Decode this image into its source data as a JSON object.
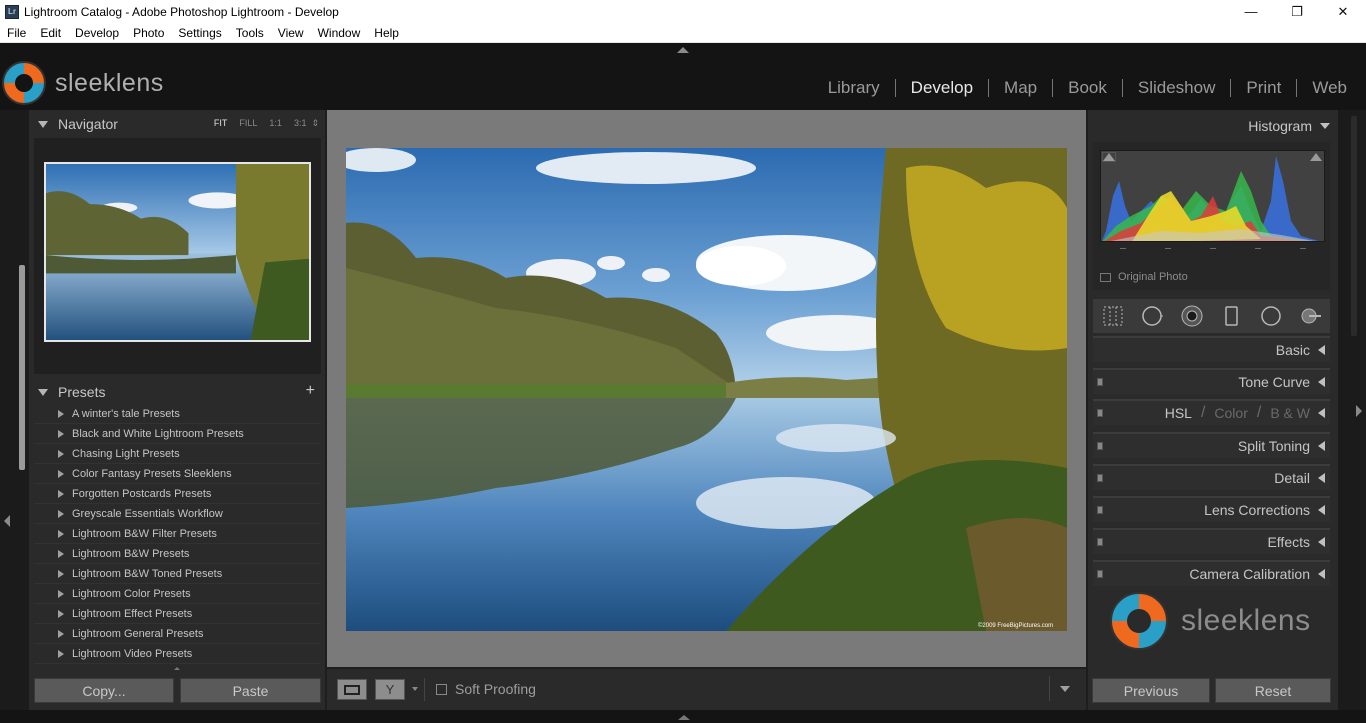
{
  "window": {
    "app_icon": "Lr",
    "title": "Lightroom Catalog - Adobe Photoshop Lightroom - Develop",
    "minimize": "—",
    "maximize": "❐",
    "close": "✕"
  },
  "menu": [
    "File",
    "Edit",
    "Develop",
    "Photo",
    "Settings",
    "Tools",
    "View",
    "Window",
    "Help"
  ],
  "header": {
    "logo_text": "sleeklens",
    "modules": [
      {
        "label": "Library",
        "active": false
      },
      {
        "label": "Develop",
        "active": true
      },
      {
        "label": "Map",
        "active": false
      },
      {
        "label": "Book",
        "active": false
      },
      {
        "label": "Slideshow",
        "active": false
      },
      {
        "label": "Print",
        "active": false
      },
      {
        "label": "Web",
        "active": false
      }
    ]
  },
  "navigator": {
    "title": "Navigator",
    "zoom": [
      "FIT",
      "FILL",
      "1:1",
      "3:1"
    ],
    "zoom_active": "FIT",
    "zoom_more": "⇕"
  },
  "presets": {
    "title": "Presets",
    "add": "+",
    "items": [
      "A winter's tale Presets",
      "Black and White Lightroom Presets",
      "Chasing Light Presets",
      "Color Fantasy Presets Sleeklens",
      "Forgotten Postcards Presets",
      "Greyscale Essentials Workflow",
      "Lightroom B&W Filter Presets",
      "Lightroom B&W Presets",
      "Lightroom B&W Toned Presets",
      "Lightroom Color Presets",
      "Lightroom Effect Presets",
      "Lightroom General Presets",
      "Lightroom Video Presets"
    ]
  },
  "left_buttons": {
    "copy": "Copy...",
    "paste": "Paste"
  },
  "photo": {
    "watermark": "©2009 FreeBigPictures.com"
  },
  "toolbar": {
    "soft_proofing": "Soft Proofing"
  },
  "histogram": {
    "title": "Histogram",
    "original_photo": "Original Photo"
  },
  "sections": {
    "basic": "Basic",
    "tone_curve": "Tone Curve",
    "hsl": "HSL",
    "color": "Color",
    "bw": "B & W",
    "split_toning": "Split Toning",
    "detail": "Detail",
    "lens_corrections": "Lens Corrections",
    "effects": "Effects",
    "camera_calibration": "Camera Calibration"
  },
  "brand_text": "sleeklens",
  "right_buttons": {
    "previous": "Previous",
    "reset": "Reset"
  }
}
